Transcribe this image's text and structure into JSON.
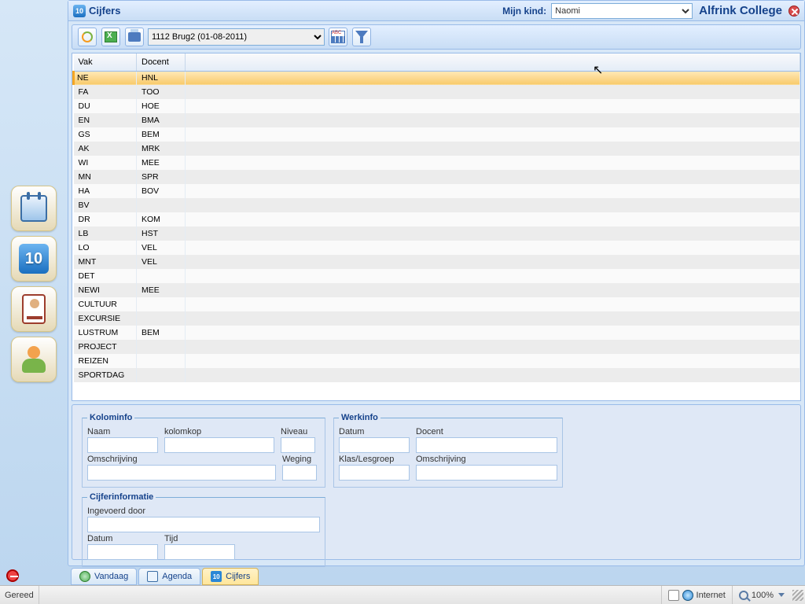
{
  "header": {
    "app_title": "Cijfers",
    "icon_text": "10",
    "child_label": "Mijn kind:",
    "child_value": "Naomi",
    "school_name": "Alfrink College"
  },
  "toolbar": {
    "period_value": "1112 Brug2 (01-08-2011)"
  },
  "grid": {
    "columns": {
      "vak": "Vak",
      "docent": "Docent"
    },
    "rows": [
      {
        "vak": "NE",
        "docent": "HNL",
        "selected": true
      },
      {
        "vak": "FA",
        "docent": "TOO"
      },
      {
        "vak": "DU",
        "docent": "HOE"
      },
      {
        "vak": "EN",
        "docent": "BMA"
      },
      {
        "vak": "GS",
        "docent": "BEM"
      },
      {
        "vak": "AK",
        "docent": "MRK"
      },
      {
        "vak": "WI",
        "docent": "MEE"
      },
      {
        "vak": "MN",
        "docent": "SPR"
      },
      {
        "vak": "HA",
        "docent": "BOV"
      },
      {
        "vak": "BV",
        "docent": ""
      },
      {
        "vak": "DR",
        "docent": "KOM"
      },
      {
        "vak": "LB",
        "docent": "HST"
      },
      {
        "vak": "LO",
        "docent": "VEL"
      },
      {
        "vak": "MNT",
        "docent": "VEL"
      },
      {
        "vak": "DET",
        "docent": ""
      },
      {
        "vak": "NEWI",
        "docent": "MEE"
      },
      {
        "vak": "CULTUUR",
        "docent": ""
      },
      {
        "vak": "EXCURSIE",
        "docent": ""
      },
      {
        "vak": "LUSTRUM",
        "docent": "BEM"
      },
      {
        "vak": "PROJECT",
        "docent": ""
      },
      {
        "vak": "REIZEN",
        "docent": ""
      },
      {
        "vak": "SPORTDAG",
        "docent": ""
      }
    ]
  },
  "form": {
    "kolominfo_legend": "Kolominfo",
    "werkinfo_legend": "Werkinfo",
    "cijferinformatie_legend": "Cijferinformatie",
    "labels": {
      "naam": "Naam",
      "kolomkop": "kolomkop",
      "niveau": "Niveau",
      "omschrijving": "Omschrijving",
      "weging": "Weging",
      "datum": "Datum",
      "docent": "Docent",
      "klaslesgroep": "Klas/Lesgroep",
      "ingevoerddoor": "Ingevoerd door",
      "tijd": "Tijd"
    }
  },
  "tabs": {
    "vandaag": "Vandaag",
    "agenda": "Agenda",
    "cijfers": "Cijfers"
  },
  "sidebar": {
    "ten_icon_text": "10"
  },
  "statusbar": {
    "ready": "Gereed",
    "zone": "Internet",
    "zoom": "100%"
  }
}
